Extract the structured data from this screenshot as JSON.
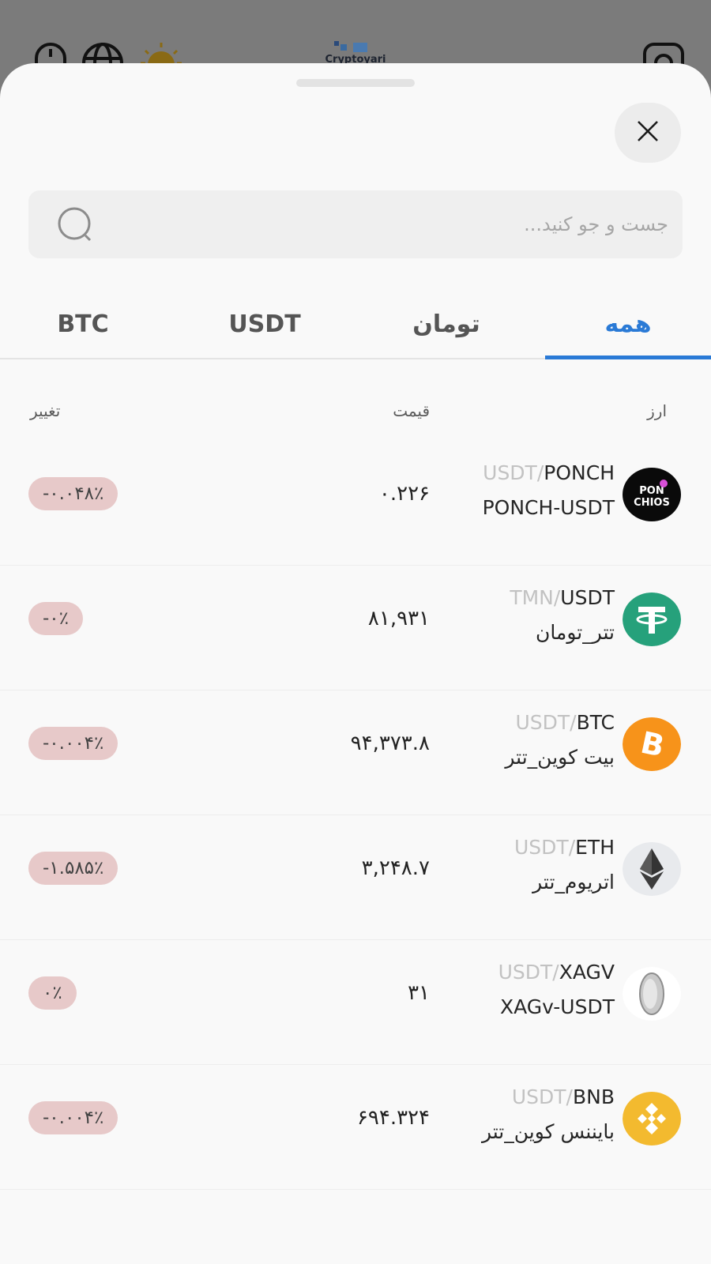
{
  "backdrop": {
    "logo_text": "Cryptoyari"
  },
  "search": {
    "placeholder": "جست و جو کنید..."
  },
  "tabs": [
    {
      "label": "همه",
      "active": true
    },
    {
      "label": "تومان",
      "active": false
    },
    {
      "label": "USDT",
      "active": false
    },
    {
      "label": "BTC",
      "active": false
    }
  ],
  "columns": {
    "currency": "ارز",
    "price": "قیمت",
    "change": "تغییر"
  },
  "rows": [
    {
      "base": "PONCH",
      "quote": "USDT",
      "name": "PONCH-USDT",
      "price": "۰.۲۲۶",
      "change": "-۰.۰۴۸٪",
      "icon": "ponch-icon"
    },
    {
      "base": "USDT",
      "quote": "TMN",
      "name": "تتر_تومان",
      "price": "۸۱,۹۳۱",
      "change": "-۰٪",
      "icon": "tether-icon"
    },
    {
      "base": "BTC",
      "quote": "USDT",
      "name": "بیت کوین_تتر",
      "price": "۹۴,۳۷۳.۸",
      "change": "-۰.۰۰۴٪",
      "icon": "bitcoin-icon"
    },
    {
      "base": "ETH",
      "quote": "USDT",
      "name": "اتریوم_تتر",
      "price": "۳,۲۴۸.۷",
      "change": "-۱.۵۸۵٪",
      "icon": "ethereum-icon"
    },
    {
      "base": "XAGV",
      "quote": "USDT",
      "name": "XAGv-USDT",
      "price": "۳۱",
      "change": "۰٪",
      "icon": "silver-coin-icon"
    },
    {
      "base": "BNB",
      "quote": "USDT",
      "name": "بایننس کوین_تتر",
      "price": "۶۹۴.۳۲۴",
      "change": "-۰.۰۰۴٪",
      "icon": "bnb-icon"
    }
  ],
  "colors": {
    "accent": "#2a7ad6",
    "change_badge": "#e7c9c9",
    "tether": "#26a17b",
    "bitcoin": "#f7931a",
    "bnb": "#f3ba2f"
  }
}
